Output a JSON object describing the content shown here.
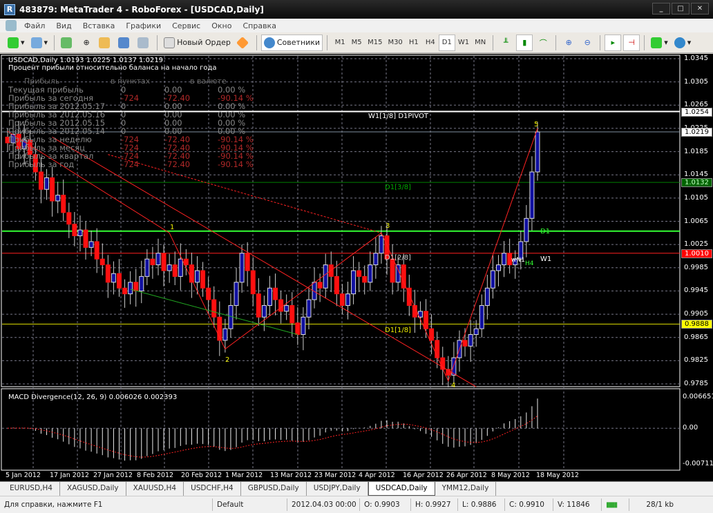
{
  "window": {
    "title": "483879: MetaTrader 4 - RoboForex - [USDCAD,Daily]"
  },
  "menu": [
    "Файл",
    "Вид",
    "Вставка",
    "Графики",
    "Сервис",
    "Окно",
    "Справка"
  ],
  "toolbar": {
    "new_order": "Новый Ордер",
    "experts": "Советники",
    "timeframes": [
      "M1",
      "M5",
      "M15",
      "M30",
      "H1",
      "H4",
      "D1",
      "W1",
      "MN"
    ],
    "active_timeframe": "D1"
  },
  "chart": {
    "header": "USDCAD,Daily  1.0193 1.0225 1.0137 1.0219",
    "subtitle": "Процент прибыли относительно баланса на начало года",
    "table_headers": [
      "Прибыль",
      "в пунктах",
      "",
      "в валюте"
    ],
    "table_rows": [
      {
        "label": "Текущая прибыль",
        "pts": "0",
        "money": "0.00",
        "pct": "0.00 %",
        "neg": false
      },
      {
        "label": "Прибыль за сегодня",
        "pts": "-724",
        "money": "-72.40",
        "pct": "-90.14 %",
        "neg": true
      },
      {
        "label": "Прибыль за 2012.05.17",
        "pts": "0",
        "money": "0.00",
        "pct": "0.00 %",
        "neg": false
      },
      {
        "label": "Прибыль за 2012.05.16",
        "pts": "0",
        "money": "0.00",
        "pct": "0.00 %",
        "neg": false
      },
      {
        "label": "Прибыль за 2012.05.15",
        "pts": "0",
        "money": "0.00",
        "pct": "0.00 %",
        "neg": false
      },
      {
        "label": "Прибыль за 2012.05.14",
        "pts": "0",
        "money": "0.00",
        "pct": "0.00 %",
        "neg": false
      },
      {
        "label": "Прибыль за неделю",
        "pts": "-724",
        "money": "-72.40",
        "pct": "-90.14 %",
        "neg": true
      },
      {
        "label": "Прибыль за месяц",
        "pts": "-724",
        "money": "-72.40",
        "pct": "-90.14 %",
        "neg": true
      },
      {
        "label": "Прибыль за квартал",
        "pts": "-724",
        "money": "-72.40",
        "pct": "-90.14 %",
        "neg": true
      },
      {
        "label": "Прибыль за год",
        "pts": "-724",
        "money": "-72.40",
        "pct": "-90.14 %",
        "neg": true
      }
    ],
    "annotations": {
      "w1pivot": "W1[1/8] D1PIVOT",
      "d1_38": "D1[3/8]",
      "d1_28": "D1[2/8]",
      "d1_18": "D1[1/8]",
      "d1": "D1",
      "w1": "W1",
      "wn1": "wN1",
      "h4": "H4",
      "p1": "1",
      "p2": "2",
      "p3": "3",
      "p4": "4",
      "p5": "5"
    },
    "macd_label": "MACD Divergence(12, 26, 9) 0.006026 0.002393",
    "macd_axis": [
      "0.006651",
      "0.00",
      "-0.00711"
    ]
  },
  "chart_data": {
    "type": "candlestick",
    "symbol": "USDCAD",
    "timeframe": "Daily",
    "ylim": [
      0.9785,
      1.0345
    ],
    "y_ticks": [
      "1.0345",
      "1.0305",
      "1.0265",
      "1.0225",
      "1.0185",
      "1.0145",
      "1.0105",
      "1.0065",
      "1.0025",
      "0.9985",
      "0.9945",
      "0.9905",
      "0.9865",
      "0.9825",
      "0.9785"
    ],
    "x_ticks": [
      "5 Jan 2012",
      "17 Jan 2012",
      "27 Jan 2012",
      "8 Feb 2012",
      "20 Feb 2012",
      "1 Mar 2012",
      "13 Mar 2012",
      "23 Mar 2012",
      "4 Apr 2012",
      "16 Apr 2012",
      "26 Apr 2012",
      "8 May 2012",
      "18 May 2012"
    ],
    "closes": [
      1.02,
      1.0215,
      1.019,
      1.0205,
      1.018,
      1.015,
      1.012,
      1.014,
      1.01,
      1.011,
      1.008,
      1.006,
      1.004,
      1.005,
      1.002,
      1.003,
      1.0,
      0.999,
      0.996,
      0.9975,
      0.995,
      0.994,
      0.996,
      0.9945,
      0.997,
      1.0,
      0.999,
      1.001,
      0.998,
      0.999,
      0.997,
      1.0,
      0.999,
      0.996,
      0.998,
      0.995,
      0.993,
      0.99,
      0.986,
      0.988,
      0.992,
      0.996,
      1.001,
      0.998,
      0.994,
      0.99,
      0.992,
      0.995,
      0.993,
      0.991,
      0.992,
      0.989,
      0.987,
      0.99,
      0.993,
      0.996,
      0.995,
      0.999,
      0.997,
      0.994,
      0.992,
      0.994,
      0.998,
      0.997,
      0.996,
      0.999,
      1.001,
      1.004,
      1.0,
      0.996,
      0.999,
      0.995,
      0.992,
      0.99,
      0.991,
      0.988,
      0.986,
      0.983,
      0.981,
      0.98,
      0.983,
      0.986,
      0.985,
      0.987,
      0.988,
      0.992,
      0.995,
      0.998,
      0.999,
      1.001,
      0.999,
      1.0,
      1.003,
      1.007,
      1.015,
      1.0219
    ],
    "levels": [
      {
        "price": "1.0254",
        "color": "#ffffff",
        "label_bg": "#ffffff",
        "label_fg": "#000000"
      },
      {
        "price": "1.0219",
        "color": "#8090a0",
        "label_bg": "#ffffff",
        "label_fg": "#000000"
      },
      {
        "price": "1.0132",
        "color": "#008000",
        "label_bg": "#006400",
        "label_fg": "#c0ffc0"
      },
      {
        "price": "1.0048",
        "color": "#33ff33",
        "label_bg": null,
        "label_fg": null
      },
      {
        "price": "1.0010",
        "color": "#ff2020",
        "label_bg": "#ff0000",
        "label_fg": "#ffffff"
      },
      {
        "price": "0.9888",
        "color": "#e0e000",
        "label_bg": "#ffff00",
        "label_fg": "#000000"
      }
    ]
  },
  "tabs": [
    "EURUSD,H4",
    "XAGUSD,Daily",
    "XAUUSD,H4",
    "USDCHF,H4",
    "GBPUSD,Daily",
    "USDJPY,Daily",
    "USDCAD,Daily",
    "YMM12,Daily"
  ],
  "active_tab": "USDCAD,Daily",
  "status": {
    "help": "Для справки, нажмите F1",
    "profile": "Default",
    "time": "2012.04.03 00:00",
    "open": "O: 0.9903",
    "high": "H: 0.9927",
    "low": "L: 0.9886",
    "close": "C: 0.9910",
    "volume": "V: 11846",
    "traffic": "28/1 kb"
  }
}
